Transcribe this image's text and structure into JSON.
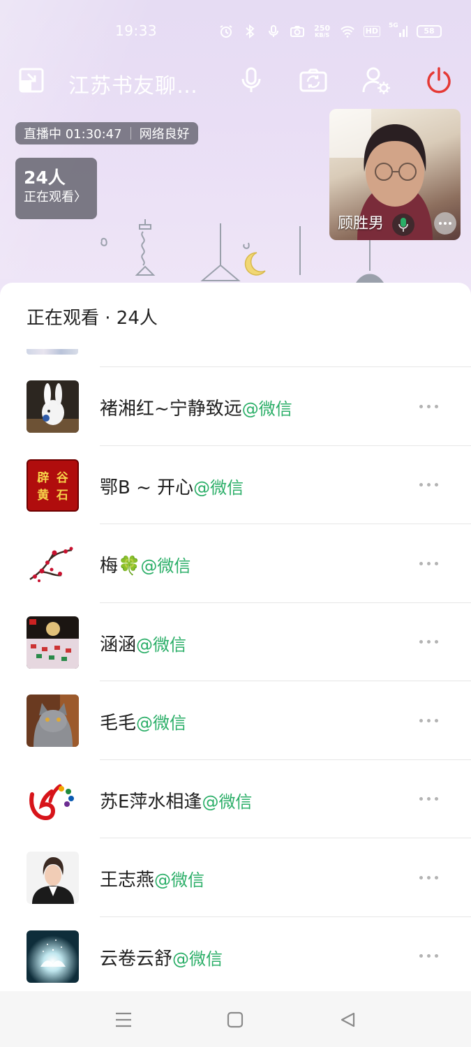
{
  "status_bar": {
    "time": "19:33",
    "speed_value": "250",
    "speed_unit": "KB/S",
    "hd_label": "HD",
    "network_label": "5G",
    "battery": "58"
  },
  "topbar": {
    "title": "江苏书友聊…",
    "icons": [
      "minimize-window-icon",
      "microphone-icon",
      "flip-camera-icon",
      "member-settings-icon",
      "power-off-icon"
    ]
  },
  "live": {
    "status_label": "直播中 01:30:47",
    "network_status": "网络良好",
    "viewer_count": "24人",
    "viewer_link": "正在观看〉"
  },
  "video_tile": {
    "name": "顾胜男"
  },
  "sheet": {
    "title": "正在观看 · 24人",
    "source_suffix": "@微信",
    "members": [
      {
        "name": "褚湘红~宁静致远",
        "source": "@微信",
        "avatar": "white-rabbit-figurine"
      },
      {
        "name": "鄂B ~ 开心",
        "source": "@微信",
        "avatar": "red-calligraphy-seal",
        "avatar_text": [
          "辟",
          "谷",
          "黄",
          "石"
        ]
      },
      {
        "name": "梅🍀",
        "source": "@微信",
        "avatar": "plum-blossom-painting"
      },
      {
        "name": "涵涵",
        "source": "@微信",
        "avatar": "festive-collage"
      },
      {
        "name": "毛毛",
        "source": "@微信",
        "avatar": "grey-cat-photo"
      },
      {
        "name": "苏E萍水相逢",
        "source": "@微信",
        "avatar": "colorful-16-logo"
      },
      {
        "name": "王志燕",
        "source": "@微信",
        "avatar": "woman-portrait"
      },
      {
        "name": "云卷云舒",
        "source": "@微信",
        "avatar": "glowing-lotus"
      }
    ]
  },
  "colors": {
    "accent_green": "#2aae67",
    "power_red": "#e53935",
    "sheet_bg": "#ffffff",
    "room_bg": "#e8ddf4"
  }
}
